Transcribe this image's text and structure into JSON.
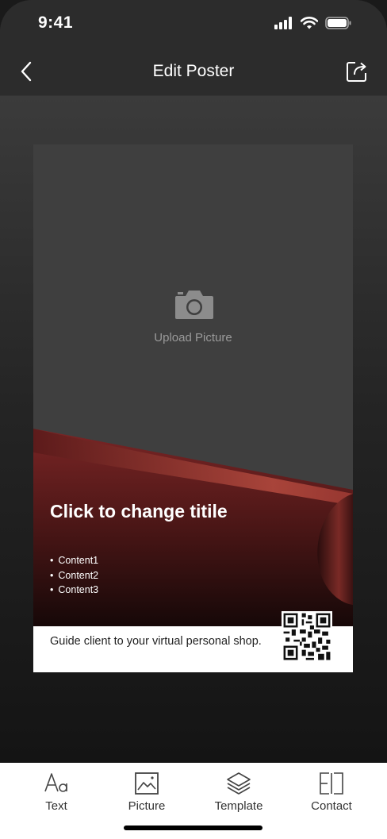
{
  "status_bar": {
    "time": "9:41",
    "icons": [
      "signal-icon",
      "wifi-icon",
      "battery-icon"
    ]
  },
  "nav": {
    "title": "Edit Poster",
    "back_icon": "chevron-left-icon",
    "share_icon": "share-icon"
  },
  "poster": {
    "upload_label": "Upload Picture",
    "upload_icon": "camera-icon",
    "title": "Click to change titile",
    "contents": [
      "Content1",
      "Content2",
      "Content3"
    ],
    "footer_text": "Guide client to your virtual personal shop.",
    "qr_icon": "qr-code-icon",
    "accent_color": "#8c2f2f"
  },
  "tabs": [
    {
      "label": "Text",
      "icon": "text-font-icon"
    },
    {
      "label": "Picture",
      "icon": "picture-icon"
    },
    {
      "label": "Template",
      "icon": "layers-icon"
    },
    {
      "label": "Contact",
      "icon": "contact-card-icon"
    }
  ]
}
